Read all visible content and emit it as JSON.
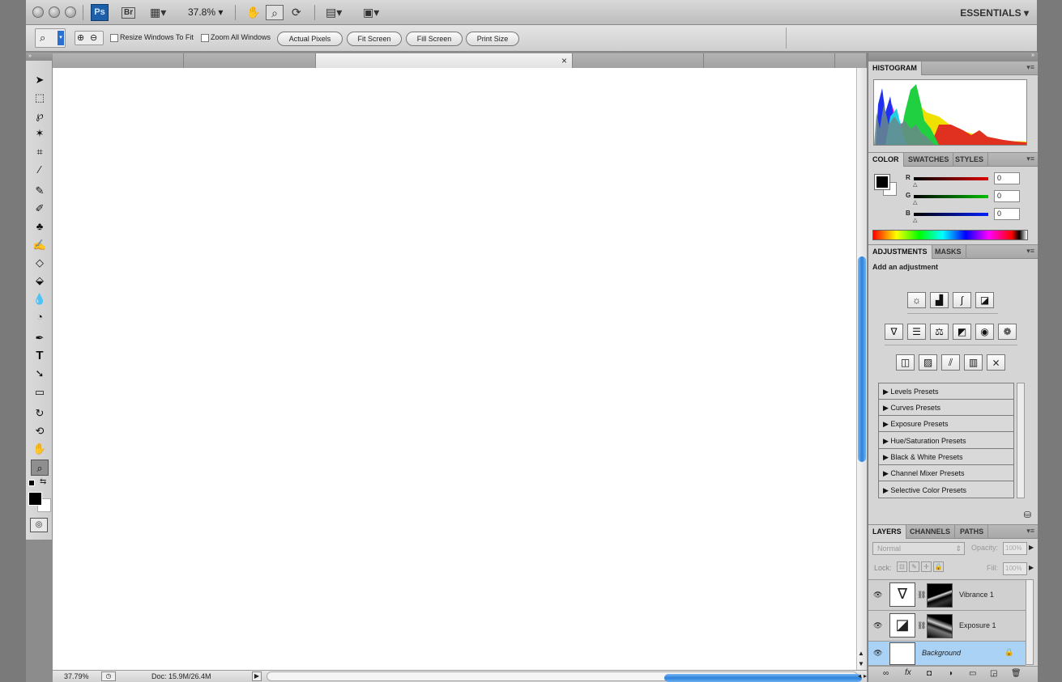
{
  "appbar": {
    "ps_label": "Ps",
    "br_label": "Br",
    "zoom": "37.8%",
    "workspace": "ESSENTIALS"
  },
  "options": {
    "resize_windows": "Resize Windows To Fit",
    "zoom_all": "Zoom All Windows",
    "buttons": [
      "Actual Pixels",
      "Fit Screen",
      "Fill Screen",
      "Print Size"
    ]
  },
  "document": {
    "close_glyph": "×"
  },
  "status": {
    "zoom": "37.79%",
    "doc_size": "Doc: 15.9M/26.4M"
  },
  "histogram": {
    "tab": "HISTOGRAM"
  },
  "color_panel": {
    "tabs": [
      "COLOR",
      "SWATCHES",
      "STYLES"
    ],
    "channels": [
      {
        "label": "R",
        "value": "0",
        "color": "#d40000"
      },
      {
        "label": "G",
        "value": "0",
        "color": "#00a000"
      },
      {
        "label": "B",
        "value": "0",
        "color": "#0010d0"
      }
    ]
  },
  "adjustments": {
    "tabs": [
      "ADJUSTMENTS",
      "MASKS"
    ],
    "heading": "Add an adjustment",
    "presets": [
      "Levels Presets",
      "Curves Presets",
      "Exposure Presets",
      "Hue/Saturation Presets",
      "Black & White Presets",
      "Channel Mixer Presets",
      "Selective Color Presets"
    ]
  },
  "layers": {
    "tabs": [
      "LAYERS",
      "CHANNELS",
      "PATHS"
    ],
    "blend_mode": "Normal",
    "opacity_label": "Opacity:",
    "opacity_value": "100%",
    "lock_label": "Lock:",
    "fill_label": "Fill:",
    "fill_value": "100%",
    "items": [
      "Vibrance 1",
      "Exposure 1",
      "Background"
    ]
  },
  "colors": {
    "accent": "#2b82dc",
    "selected_layer": "#a9d2f5"
  }
}
